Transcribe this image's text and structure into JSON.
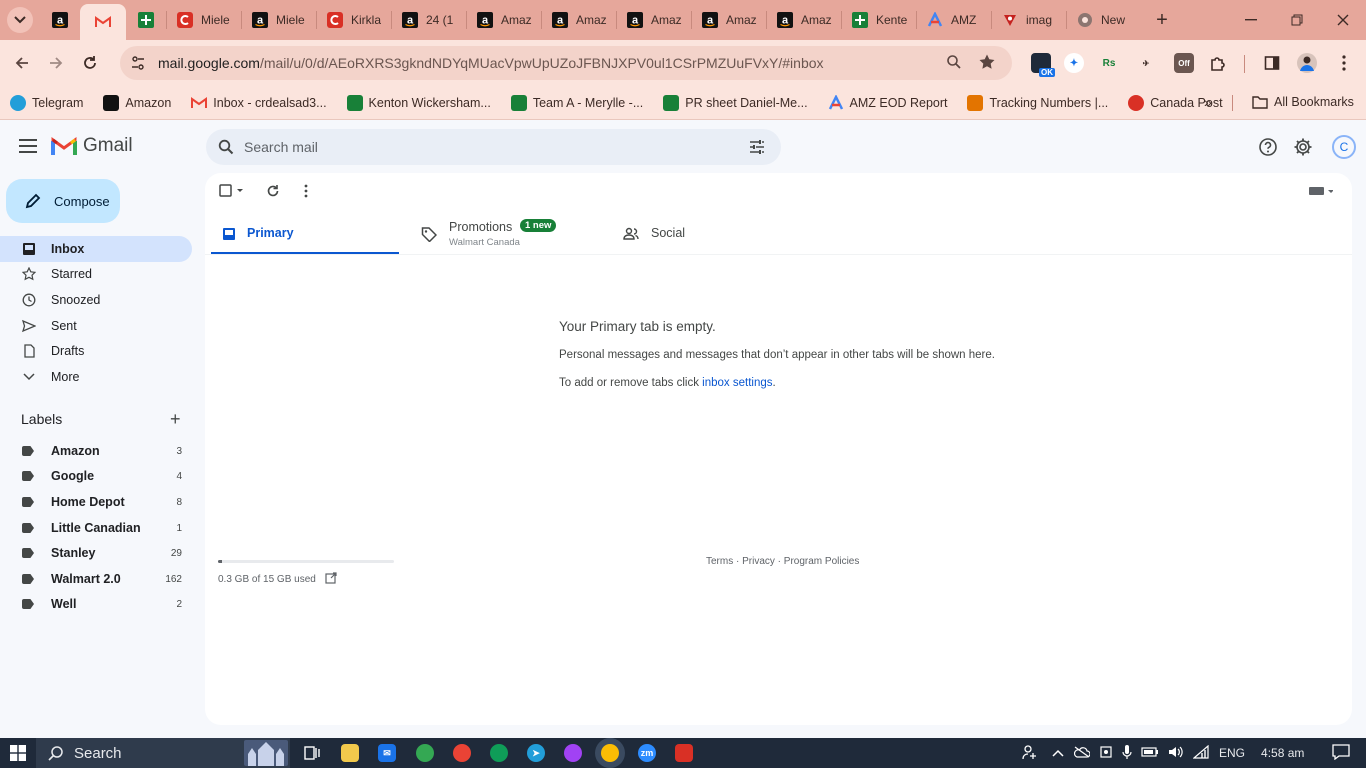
{
  "browser": {
    "tabs": [
      {
        "title": "",
        "icon": "amazon-icon",
        "color": "#111111"
      },
      {
        "title": "",
        "icon": "gmail-icon",
        "color": "#ea4335",
        "active": true
      },
      {
        "title": "",
        "icon": "sheets-icon",
        "color": "#188038"
      },
      {
        "title": "Miele",
        "icon": "c-icon",
        "color": "#d93025"
      },
      {
        "title": "Miele",
        "icon": "amazon-icon",
        "color": "#111111"
      },
      {
        "title": "Kirkla",
        "icon": "c-icon",
        "color": "#d93025"
      },
      {
        "title": "24 (1",
        "icon": "amazon-icon",
        "color": "#111111"
      },
      {
        "title": "Amaz",
        "icon": "amazon-icon",
        "color": "#111111"
      },
      {
        "title": "Amaz",
        "icon": "amazon-icon",
        "color": "#111111"
      },
      {
        "title": "Amaz",
        "icon": "amazon-icon",
        "color": "#111111"
      },
      {
        "title": "Amaz",
        "icon": "amazon-icon",
        "color": "#111111"
      },
      {
        "title": "Amaz",
        "icon": "amazon-icon",
        "color": "#111111"
      },
      {
        "title": "Kente",
        "icon": "sheets-icon",
        "color": "#188038"
      },
      {
        "title": "AMZ",
        "icon": "amz-eod-icon",
        "color": "#4285f4"
      },
      {
        "title": "imag",
        "icon": "pin-icon",
        "color": "#c5221f"
      },
      {
        "title": "New",
        "icon": "chrome-icon",
        "color": "#5f6368"
      }
    ],
    "url_host": "mail.google.com",
    "url_rest": "/mail/u/0/d/AEoRXRS3gkndNDYqMUacVpwUpUZoJFBNJXPV0ul1CSrPMZUuFVxY/#inbox",
    "bookmarks": [
      {
        "label": "Telegram",
        "color": "#229ed9"
      },
      {
        "label": "Amazon",
        "color": "#111111"
      },
      {
        "label": "Inbox - crdealsad3...",
        "color": "#ea4335"
      },
      {
        "label": "Kenton Wickersham...",
        "color": "#188038"
      },
      {
        "label": "Team A - Merylle -...",
        "color": "#188038"
      },
      {
        "label": "PR sheet Daniel-Me...",
        "color": "#188038"
      },
      {
        "label": "AMZ EOD Report",
        "color": "#4285f4"
      },
      {
        "label": "Tracking Numbers |...",
        "color": "#e37400"
      },
      {
        "label": "Canada Post",
        "color": "#d93025"
      }
    ],
    "all_bookmarks": "All Bookmarks",
    "ext_ok": "OK",
    "ext_off": "Off"
  },
  "gmail": {
    "logo_text": "Gmail",
    "search_placeholder": "Search mail",
    "avatar_initial": "C",
    "compose": "Compose",
    "nav": [
      {
        "label": "Inbox",
        "icon": "inbox-icon",
        "active": true
      },
      {
        "label": "Starred",
        "icon": "star-icon"
      },
      {
        "label": "Snoozed",
        "icon": "clock-icon"
      },
      {
        "label": "Sent",
        "icon": "send-icon"
      },
      {
        "label": "Drafts",
        "icon": "draft-icon"
      },
      {
        "label": "More",
        "icon": "chevron-down-icon"
      }
    ],
    "labels_heading": "Labels",
    "labels": [
      {
        "name": "Amazon",
        "count": "3"
      },
      {
        "name": "Google",
        "count": "4"
      },
      {
        "name": "Home Depot",
        "count": "8"
      },
      {
        "name": "Little Canadian",
        "count": "1"
      },
      {
        "name": "Stanley",
        "count": "29"
      },
      {
        "name": "Walmart 2.0",
        "count": "162"
      },
      {
        "name": "Well",
        "count": "2"
      }
    ],
    "tabs": {
      "primary": "Primary",
      "promotions": "Promotions",
      "promotions_badge": "1 new",
      "promotions_sub": "Walmart Canada",
      "social": "Social"
    },
    "empty": {
      "title": "Your Primary tab is empty.",
      "desc": "Personal messages and messages that don’t appear in other tabs will be shown here.",
      "settings_prefix": "To add or remove tabs click ",
      "settings_link": "inbox settings",
      "settings_suffix": "."
    },
    "storage_text": "0.3 GB of 15 GB used",
    "storage_fraction": 0.02,
    "footer": "Terms · Privacy · Program Policies"
  },
  "taskbar": {
    "search_placeholder": "Search",
    "language": "ENG",
    "time": "4:58 am",
    "zoom_label": "zm"
  }
}
